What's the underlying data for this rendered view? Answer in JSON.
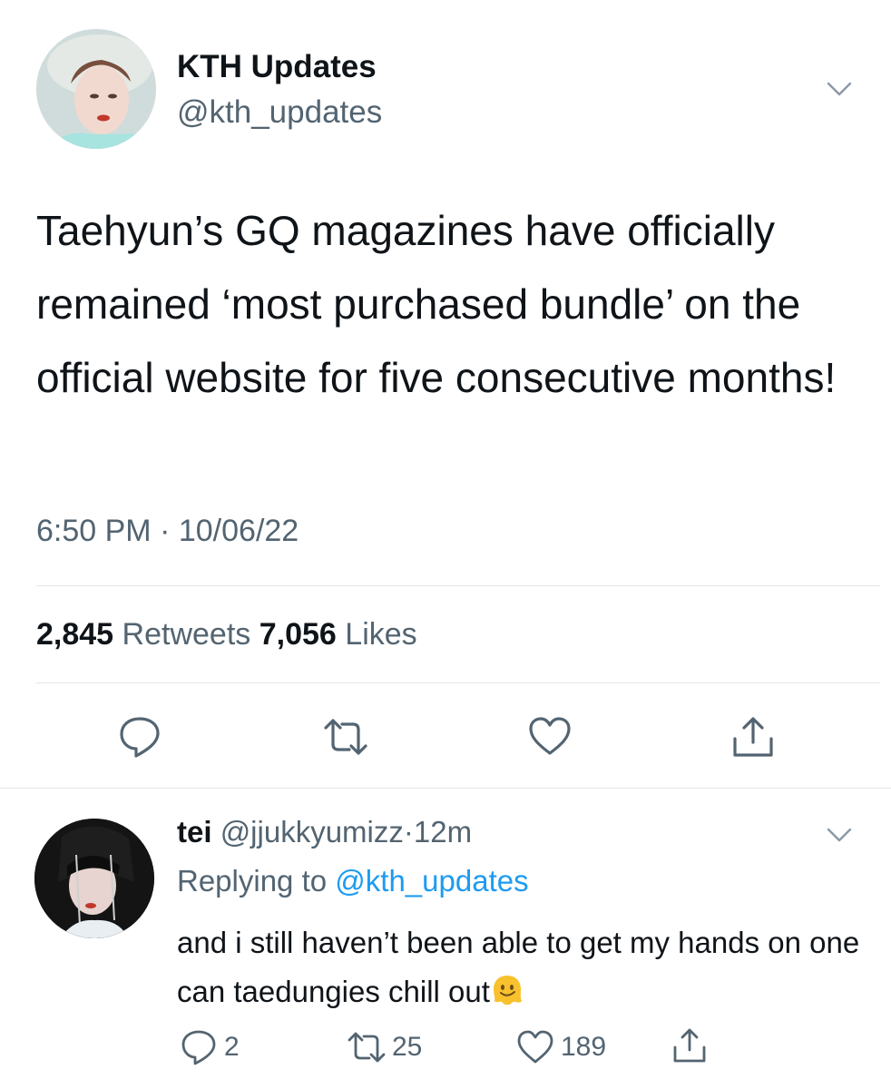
{
  "tweet": {
    "display_name": "KTH Updates",
    "handle": "@kth_updates",
    "text": "Taehyun’s GQ magazines have officially remained ‘most purchased bundle’ on the official website for five consecutive months!",
    "time": "6:50 PM",
    "separator": "·",
    "date": "10/06/22",
    "retweets_count": "2,845",
    "retweets_label": "Retweets",
    "likes_count": "7,056",
    "likes_label": "Likes",
    "icons": [
      "chevron-down-icon",
      "reply-icon",
      "retweet-icon",
      "like-icon",
      "share-icon"
    ]
  },
  "reply": {
    "display_name": "tei",
    "handle": "@jjukkyumizz",
    "separator": "·",
    "age": "12m",
    "replying_prefix": "Replying to",
    "replying_handle": "@kth_updates",
    "text": "and i still haven’t been able to get my hands on one can taedungies chill out",
    "reply_count": "2",
    "retweet_count": "25",
    "like_count": "189",
    "icons": [
      "chevron-down-icon",
      "reply-icon",
      "retweet-icon",
      "like-icon",
      "share-icon",
      "melting-face-emoji"
    ]
  },
  "colors": {
    "text_primary": "#0f1419",
    "text_secondary": "#536471",
    "link": "#1d9bf0",
    "divider": "#e1e5e8",
    "icon": "#536471"
  }
}
